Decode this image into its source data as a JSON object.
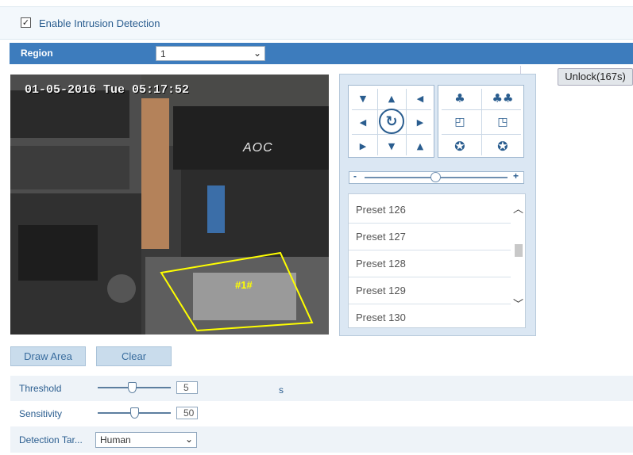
{
  "enable": {
    "label": "Enable Intrusion Detection",
    "checked": true,
    "check_glyph": "✓"
  },
  "region": {
    "label": "Region",
    "value": "1"
  },
  "unlock_button": "Unlock(167s)",
  "video": {
    "osd_time": "01-05-2016 Tue 05:17:52",
    "brand_text": "AOC",
    "area_label": "#1#"
  },
  "ptz": {
    "icons": [
      "arrow-up-left-icon",
      "arrow-up-icon",
      "arrow-up-right-icon",
      "arrow-left-icon",
      "auto-rotate-icon",
      "arrow-right-icon",
      "arrow-down-left-icon",
      "arrow-down-icon",
      "arrow-down-right-icon",
      "zoom-in-icon",
      "zoom-out-icon",
      "focus-near-icon",
      "focus-far-icon",
      "iris-open-icon",
      "iris-close-icon"
    ],
    "speed_minus": "-",
    "speed_plus": "+"
  },
  "presets": [
    "Preset 126",
    "Preset 127",
    "Preset 128",
    "Preset 129",
    "Preset 130"
  ],
  "buttons": {
    "draw_area": "Draw Area",
    "clear": "Clear"
  },
  "params": {
    "threshold": {
      "label": "Threshold",
      "value": "5",
      "unit": "s",
      "level": 0.45
    },
    "sensitivity": {
      "label": "Sensitivity",
      "value": "50",
      "level": 0.5
    },
    "detection_target": {
      "label": "Detection Tar...",
      "value": "Human"
    }
  },
  "colors": {
    "accent": "#3d7cbd",
    "area_outline": "#ffff00"
  }
}
